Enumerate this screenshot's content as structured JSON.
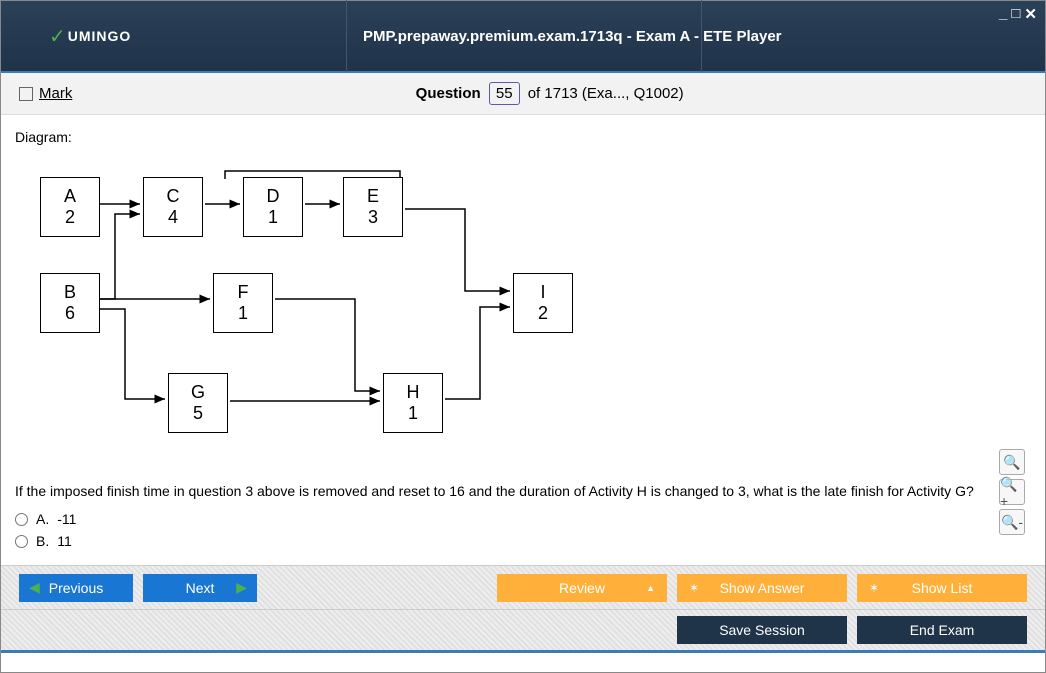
{
  "window": {
    "brand": "UMINGO",
    "title": "PMP.prepaway.premium.exam.1713q - Exam A - ETE Player"
  },
  "questionBar": {
    "markLabel": "Mark",
    "questionWord": "Question",
    "current": "55",
    "ofLabel": "of 1713 (Exa..., Q1002)"
  },
  "content": {
    "diagramLabel": "Diagram:",
    "nodes": {
      "A": {
        "name": "A",
        "dur": "2"
      },
      "B": {
        "name": "B",
        "dur": "6"
      },
      "C": {
        "name": "C",
        "dur": "4"
      },
      "D": {
        "name": "D",
        "dur": "1"
      },
      "E": {
        "name": "E",
        "dur": "3"
      },
      "F": {
        "name": "F",
        "dur": "1"
      },
      "G": {
        "name": "G",
        "dur": "5"
      },
      "H": {
        "name": "H",
        "dur": "1"
      },
      "I": {
        "name": "I",
        "dur": "2"
      }
    },
    "question": "If the imposed finish time in question 3 above is removed and reset to 16 and the duration of Activity H is changed to 3, what is the late finish for Activity G?",
    "options": {
      "A": {
        "letter": "A.",
        "text": "-11"
      },
      "B": {
        "letter": "B.",
        "text": "11"
      }
    }
  },
  "buttons": {
    "previous": "Previous",
    "next": "Next",
    "review": "Review",
    "showAnswer": "Show Answer",
    "showList": "Show List",
    "saveSession": "Save Session",
    "endExam": "End Exam"
  }
}
